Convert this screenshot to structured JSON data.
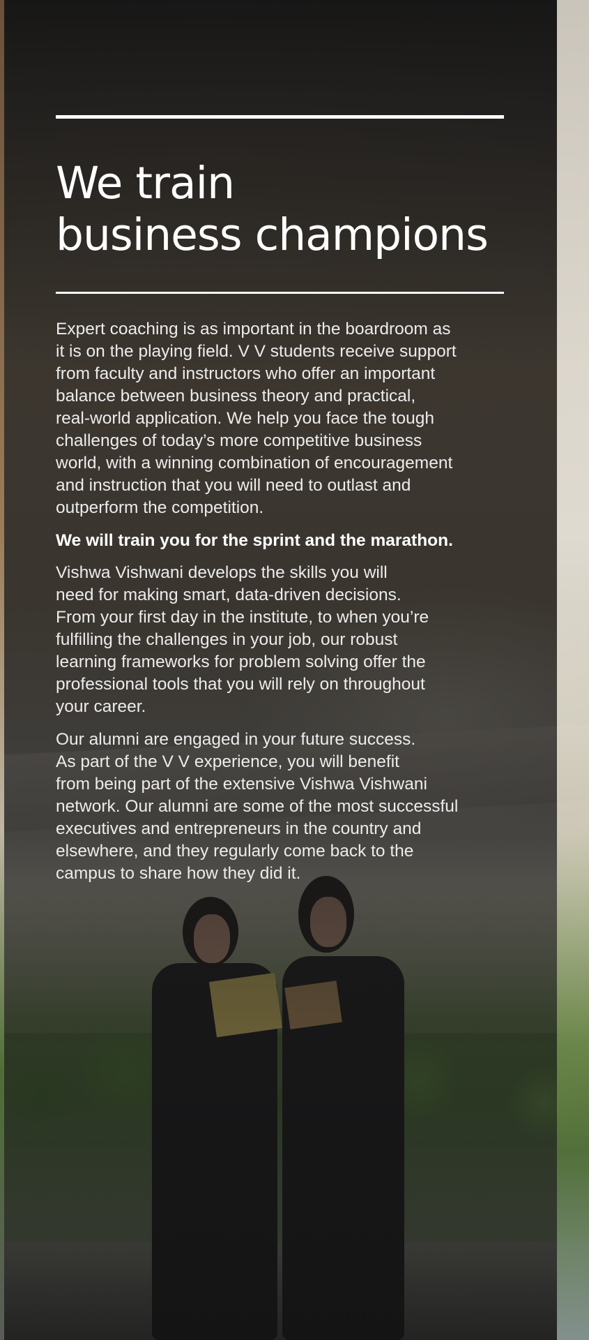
{
  "headline": {
    "line1": "We train",
    "line2": "business champions"
  },
  "paragraphs": {
    "p1": "Expert coaching is as important in the boardroom as\nit is on the playing field. V V students receive support\nfrom faculty and instructors who offer an important\nbalance between business theory and practical,\nreal-world application. We help you face the tough\nchallenges of today’s more competitive business\nworld, with a winning combination of encouragement\nand instruction that you will need to outlast and\noutperform the competition.",
    "p2": "We will train you for the sprint and the marathon.",
    "p3": "Vishwa Vishwani develops the skills  you will\nneed for making smart, data-driven decisions.\nFrom your first day in the institute, to when you’re\nfulfilling the challenges in your job, our robust\nlearning frameworks for problem solving offer the\nprofessional tools that you will rely on throughout\nyour career.",
    "p4": "Our alumni are engaged in your future success.\nAs part of the V V experience, you will benefit\nfrom being part of the extensive Vishwa Vishwani\nnetwork. Our alumni are some of the most successful\nexecutives and entrepreneurs in the country and\nelsewhere, and they regularly come back to the\ncampus to share how they did it."
  },
  "colors": {
    "panel": "#191919",
    "text": "#ffffff",
    "body_text": "#ececec"
  }
}
